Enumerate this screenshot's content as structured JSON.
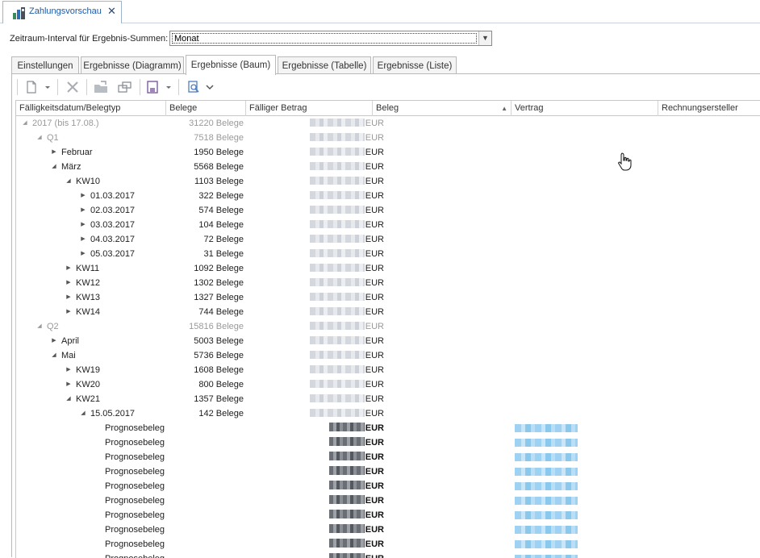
{
  "document_tab": {
    "title": "Zahlungsvorschau",
    "close_glyph": "✕",
    "icon": "report-icon"
  },
  "interval": {
    "label": "Zeitraum-Interval für Ergebnis-Summen:",
    "value": "Monat",
    "dropdown_glyph": "▼"
  },
  "result_tabs": [
    {
      "label": "Einstellungen"
    },
    {
      "label": "Ergebnisse (Diagramm)"
    },
    {
      "label": "Ergebnisse (Baum)"
    },
    {
      "label": "Ergebnisse (Tabelle)"
    },
    {
      "label": "Ergebnisse (Liste)"
    }
  ],
  "toolbar": {
    "icons": [
      "new-document-icon",
      "dropdown-arrow-icon",
      "delete-icon",
      "move-folder-icon",
      "link-window-icon",
      "save-icon",
      "dropdown-arrow-icon",
      "preview-icon",
      "chevron-down-icon"
    ]
  },
  "columns": [
    {
      "label": "Fälligkeitsdatum/Belegtyp"
    },
    {
      "label": "Belege"
    },
    {
      "label": "Fälliger Betrag"
    },
    {
      "label": "Beleg",
      "sort": "▲"
    },
    {
      "label": "Vertrag"
    },
    {
      "label": "Rechnungsersteller"
    }
  ],
  "rows": [
    {
      "label": "2017 (bis 17.08.)",
      "count": "31220 Belege",
      "currency": "EUR",
      "level": 0,
      "expanded": true,
      "summary": true,
      "glyph": "◢"
    },
    {
      "label": "Q1",
      "count": "7518 Belege",
      "currency": "EUR",
      "level": 1,
      "expanded": true,
      "summary": true,
      "glyph": "◢"
    },
    {
      "label": "Februar",
      "count": "1950 Belege",
      "currency": "EUR",
      "level": 2,
      "glyph": "▶"
    },
    {
      "label": "März",
      "count": "5568 Belege",
      "currency": "EUR",
      "level": 2,
      "glyph": "◢"
    },
    {
      "label": "KW10",
      "count": "1103 Belege",
      "currency": "EUR",
      "level": 3,
      "glyph": "◢"
    },
    {
      "label": "01.03.2017",
      "count": "322 Belege",
      "currency": "EUR",
      "level": 4,
      "glyph": "▶"
    },
    {
      "label": "02.03.2017",
      "count": "574 Belege",
      "currency": "EUR",
      "level": 4,
      "glyph": "▶"
    },
    {
      "label": "03.03.2017",
      "count": "104 Belege",
      "currency": "EUR",
      "level": 4,
      "glyph": "▶"
    },
    {
      "label": "04.03.2017",
      "count": "72 Belege",
      "currency": "EUR",
      "level": 4,
      "glyph": "▶"
    },
    {
      "label": "05.03.2017",
      "count": "31 Belege",
      "currency": "EUR",
      "level": 4,
      "glyph": "▶"
    },
    {
      "label": "KW11",
      "count": "1092 Belege",
      "currency": "EUR",
      "level": 3,
      "glyph": "▶"
    },
    {
      "label": "KW12",
      "count": "1302 Belege",
      "currency": "EUR",
      "level": 3,
      "glyph": "▶"
    },
    {
      "label": "KW13",
      "count": "1327 Belege",
      "currency": "EUR",
      "level": 3,
      "glyph": "▶"
    },
    {
      "label": "KW14",
      "count": "744 Belege",
      "currency": "EUR",
      "level": 3,
      "glyph": "▶"
    },
    {
      "label": "Q2",
      "count": "15816 Belege",
      "currency": "EUR",
      "level": 1,
      "summary": true,
      "glyph": "◢"
    },
    {
      "label": "April",
      "count": "5003 Belege",
      "currency": "EUR",
      "level": 2,
      "glyph": "▶"
    },
    {
      "label": "Mai",
      "count": "5736 Belege",
      "currency": "EUR",
      "level": 2,
      "glyph": "◢"
    },
    {
      "label": "KW19",
      "count": "1608 Belege",
      "currency": "EUR",
      "level": 3,
      "glyph": "▶"
    },
    {
      "label": "KW20",
      "count": "800 Belege",
      "currency": "EUR",
      "level": 3,
      "glyph": "▶"
    },
    {
      "label": "KW21",
      "count": "1357 Belege",
      "currency": "EUR",
      "level": 3,
      "glyph": "◢"
    },
    {
      "label": "15.05.2017",
      "count": "142 Belege",
      "currency": "EUR",
      "level": 4,
      "glyph": "◢"
    },
    {
      "label": "Prognosebeleg",
      "currency": "EUR",
      "level": 5,
      "detail": true
    },
    {
      "label": "Prognosebeleg",
      "currency": "EUR",
      "level": 5,
      "detail": true
    },
    {
      "label": "Prognosebeleg",
      "currency": "EUR",
      "level": 5,
      "detail": true
    },
    {
      "label": "Prognosebeleg",
      "currency": "EUR",
      "level": 5,
      "detail": true
    },
    {
      "label": "Prognosebeleg",
      "currency": "EUR",
      "level": 5,
      "detail": true
    },
    {
      "label": "Prognosebeleg",
      "currency": "EUR",
      "level": 5,
      "detail": true
    },
    {
      "label": "Prognosebeleg",
      "currency": "EUR",
      "level": 5,
      "detail": true
    },
    {
      "label": "Prognosebeleg",
      "currency": "EUR",
      "level": 5,
      "detail": true
    },
    {
      "label": "Prognosebeleg",
      "currency": "EUR",
      "level": 5,
      "detail": true
    },
    {
      "label": "Prognosebeleg",
      "currency": "EUR",
      "level": 5,
      "detail": true
    }
  ],
  "colors": {
    "accent": "#1e5aa8",
    "summary_text": "#9a9a9a",
    "link_blur": "#9fd2f2"
  }
}
